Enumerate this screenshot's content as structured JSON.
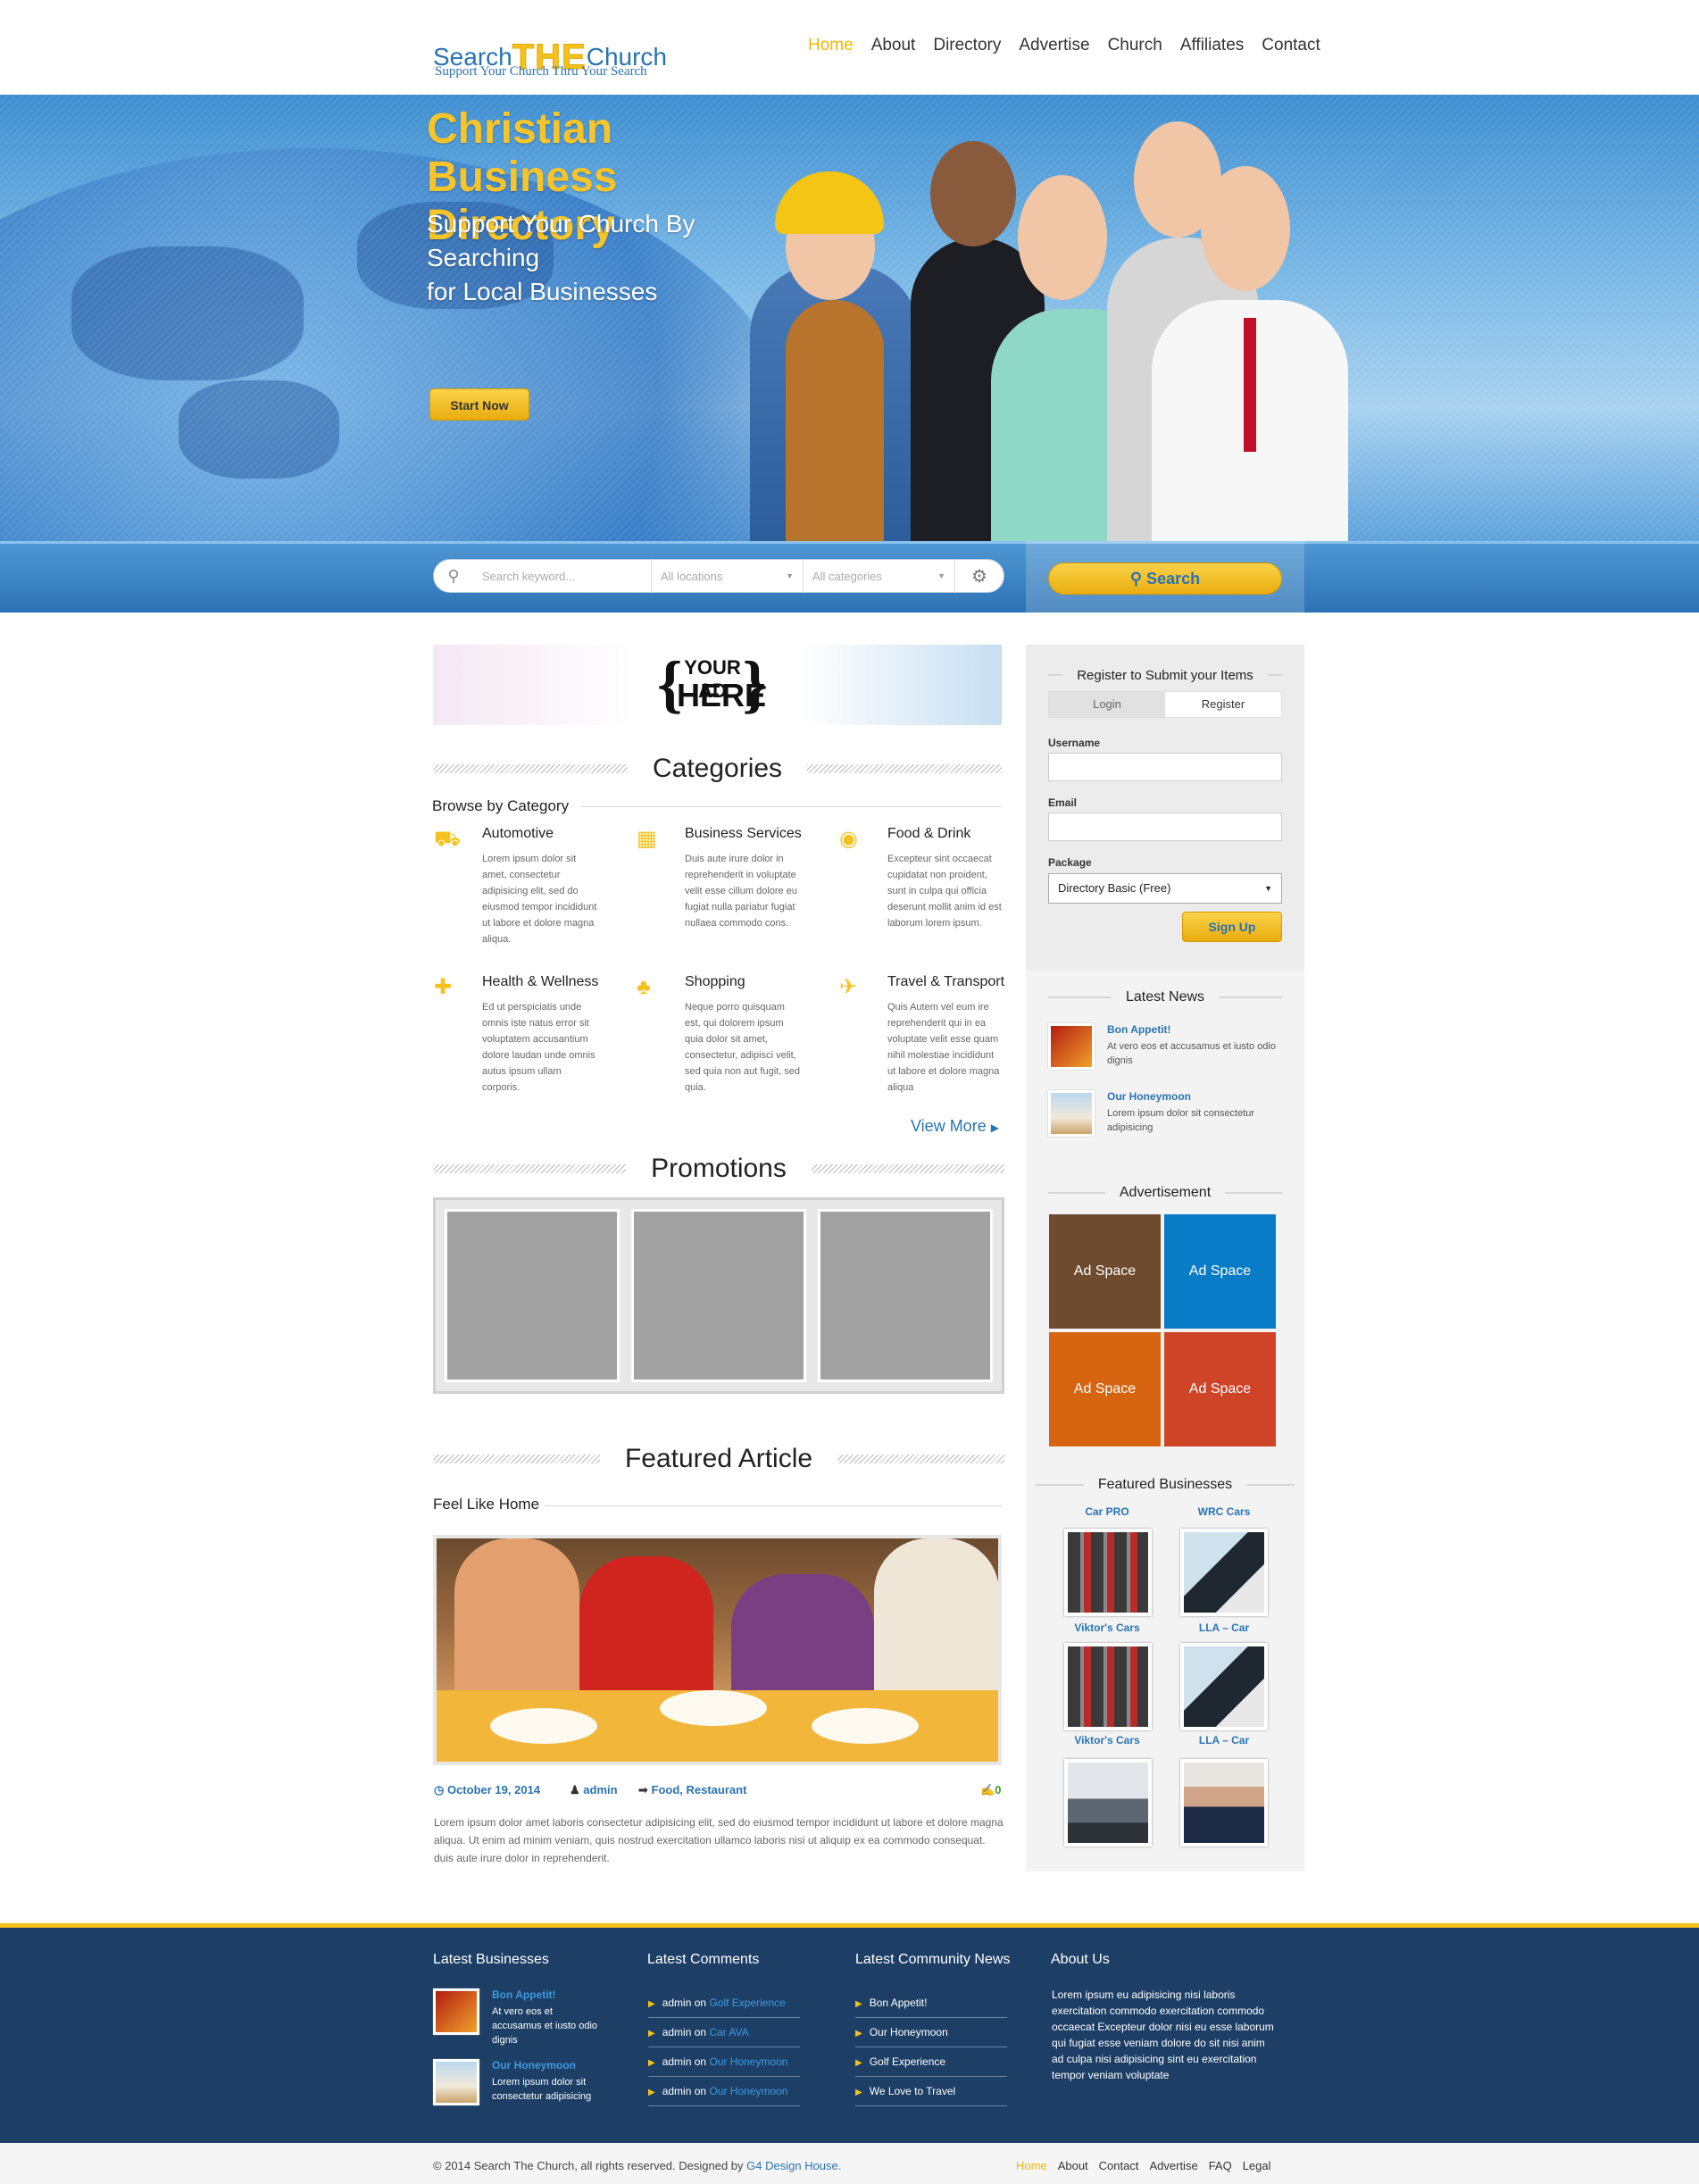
{
  "header": {
    "logo_part1": "Search",
    "logo_part2": "THE",
    "logo_part3": "Church",
    "logo_tagline": "Support Your Church Thru Your Search",
    "nav": [
      "Home",
      "About",
      "Directory",
      "Advertise",
      "Church",
      "Affiliates",
      "Contact"
    ],
    "active_nav": "Home"
  },
  "hero": {
    "title_line1": "Christian",
    "title_line2": "Business Directory",
    "subtitle_line1": "Support Your Church By Searching",
    "subtitle_line2": "for Local Businesses",
    "cta": "Start Now"
  },
  "search": {
    "keyword_placeholder": "Search keyword...",
    "locations": "All locations",
    "categories": "All categories",
    "button": "Search",
    "icons": [
      "search-icon",
      "settings-gear-icon"
    ]
  },
  "ad_banner": {
    "line1": "YOUR AD",
    "line2": "HERE"
  },
  "categories": {
    "title": "Categories",
    "browse": "Browse by Category",
    "items": [
      {
        "title": "Automotive",
        "icon": "truck-icon",
        "text": "Lorem ipsum dolor sit amet, consectetur adipisicing elit, sed do eiusmod tempor incididunt ut labore et dolore magna aliqua."
      },
      {
        "title": "Business Services",
        "icon": "buildings-icon",
        "text": "Duis aute irure dolor in reprehenderit in voluptate velit esse cillum dolore eu fugiat nulla pariatur fugiat nullaea commodo cons."
      },
      {
        "title": "Food & Drink",
        "icon": "plate-icon",
        "text": "Excepteur sint occaecat cupidatat non proident, sunt in culpa qui officia deserunt mollit anim id est laborum lorem ipsum."
      },
      {
        "title": "Health & Wellness",
        "icon": "medical-kit-icon",
        "text": "Ed ut perspiciatis unde omnis iste natus error sit voluptatem accusantium dolore laudan unde omnis autus ipsum ullam corporis."
      },
      {
        "title": "Shopping",
        "icon": "basket-icon",
        "text": "Neque porro quisquam est, qui dolorem ipsum quia dolor sit amet, consectetur, adipisci velit, sed quia non aut fugit, sed quia."
      },
      {
        "title": "Travel & Transport",
        "icon": "airplane-icon",
        "text": "Quis Autem vel eum ire reprehenderit qui in ea voluptate velit esse quam nihil molestiae incididunt ut labore et dolore magna aliqua"
      }
    ],
    "view_more": "View More"
  },
  "promotions": {
    "title": "Promotions"
  },
  "featured": {
    "title": "Featured Article",
    "article_title": "Feel Like Home",
    "date": "October 19, 2014",
    "author": "admin",
    "tags": "Food, Restaurant",
    "comments": "0",
    "text": "Lorem ipsum dolor amet laboris consectetur adipisicing elit, sed do eiusmod tempor incididunt ut labore et dolore magna aliqua. Ut enim ad minim veniam, quis nostrud exercitation ullamco laboris nisi ut aliquip ex ea commodo consequat. duis aute irure dolor in reprehenderit."
  },
  "sidebar": {
    "register_title": "Register to Submit your Items",
    "tab_login": "Login",
    "tab_register": "Register",
    "username_label": "Username",
    "email_label": "Email",
    "package_label": "Package",
    "package_value": "Directory Basic (Free)",
    "signup": "Sign Up",
    "news_title": "Latest News",
    "news": [
      {
        "title": "Bon Appetit!",
        "text": "At vero eos et accusamus et iusto odio dignis"
      },
      {
        "title": "Our Honeymoon",
        "text": "Lorem ipsum dolor sit consectetur adipisicing"
      }
    ],
    "ad_title": "Advertisement",
    "ads": [
      {
        "label": "Ad Space",
        "color": "#6e4a2e"
      },
      {
        "label": "Ad Space",
        "color": "#0a7bc6"
      },
      {
        "label": "Ad Space",
        "color": "#d66411"
      },
      {
        "label": "Ad Space",
        "color": "#cf4326"
      }
    ],
    "featured_title": "Featured Businesses",
    "businesses": [
      "Car PRO",
      "WRC Cars",
      "Viktor's Cars",
      "LLA – Car",
      "Viktor's Cars",
      "LLA – Car"
    ]
  },
  "footer": {
    "col1_title": "Latest Businesses",
    "col1_items": [
      {
        "title": "Bon Appetit!",
        "text": "At vero eos et accusamus et iusto odio dignis"
      },
      {
        "title": "Our Honeymoon",
        "text": "Lorem ipsum dolor sit consectetur adipisicing"
      }
    ],
    "col2_title": "Latest Comments",
    "comments": [
      {
        "who": "admin",
        "on": "on",
        "target": "Golf Experience"
      },
      {
        "who": "admin",
        "on": "on",
        "target": "Car AVA"
      },
      {
        "who": "admin",
        "on": "on",
        "target": "Our Honeymoon"
      },
      {
        "who": "admin",
        "on": "on",
        "target": "Our Honeymoon"
      }
    ],
    "col3_title": "Latest Community News",
    "community": [
      "Bon Appetit!",
      "Our Honeymoon",
      "Golf Experience",
      "We Love to Travel"
    ],
    "col4_title": "About Us",
    "about_text": "Lorem ipsum eu adipisicing nisi laboris exercitation commodo exercitation commodo occaecat Excepteur dolor nisi eu esse laborum qui fugiat esse veniam dolore do sit nisi anim ad culpa nisi adipisicing sint eu exercitation tempor veniam voluptate",
    "copyright": "© 2014 Search The Church, all rights reserved. Designed by",
    "designer": "G4 Design House.",
    "nav": [
      "Home",
      "About",
      "Contact",
      "Advertise",
      "FAQ",
      "Legal"
    ]
  },
  "colors": {
    "accent": "#f5c21d",
    "brand": "#2a73b3",
    "footer": "#1d3f66"
  }
}
